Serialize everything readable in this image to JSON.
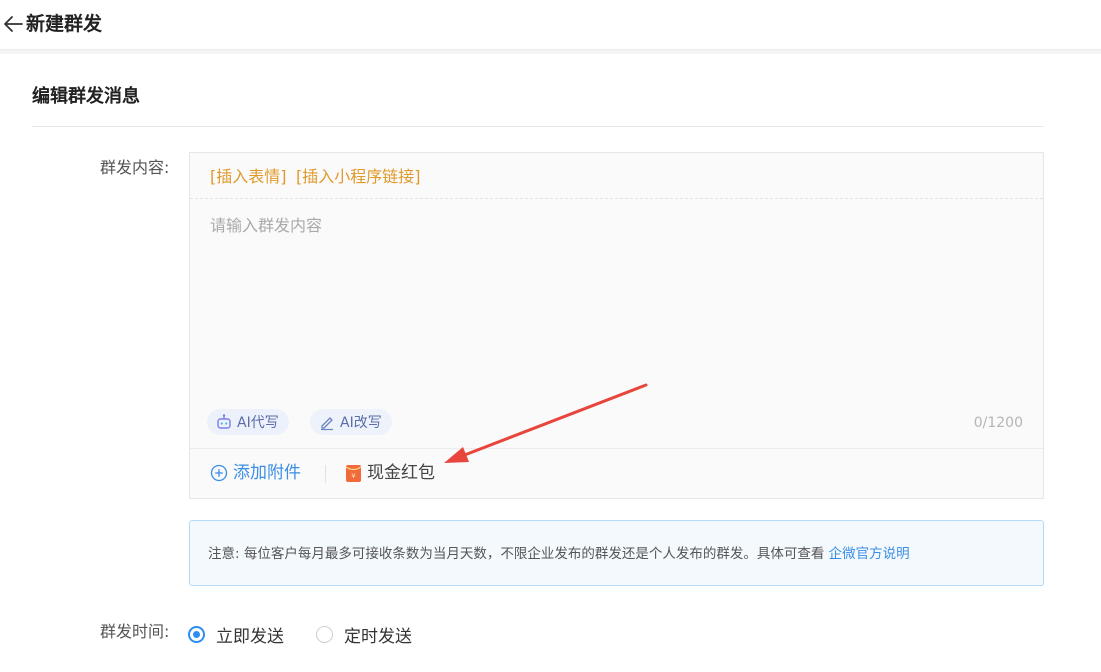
{
  "header": {
    "title": "新建群发"
  },
  "section": {
    "title": "编辑群发消息"
  },
  "content_field": {
    "label": "群发内容:",
    "insert_emoji": "[插入表情]",
    "insert_miniprogram": "[插入小程序链接]",
    "placeholder": "请输入群发内容",
    "value": "",
    "ai_write": "AI代写",
    "ai_rewrite": "AI改写",
    "counter": "0/1200",
    "add_attachment": "添加附件",
    "cash_red_packet": "现金红包"
  },
  "notice": {
    "text": "注意:  每位客户每月最多可接收条数为当月天数，不限企业发布的群发还是个人发布的群发。具体可查看 ",
    "link": "企微官方说明"
  },
  "send_time": {
    "label": "群发时间:",
    "options": [
      {
        "label": "立即发送",
        "selected": true
      },
      {
        "label": "定时发送",
        "selected": false
      }
    ]
  },
  "colors": {
    "accent_blue": "#3a8ee6",
    "insert_orange": "#e09a2b",
    "annotation_red": "#e8453c"
  },
  "icons": {
    "back": "arrow-left-icon",
    "ai_write": "robot-icon",
    "ai_rewrite": "pencil-icon",
    "attach": "plus-circle-icon",
    "red_packet": "red-packet-icon"
  }
}
